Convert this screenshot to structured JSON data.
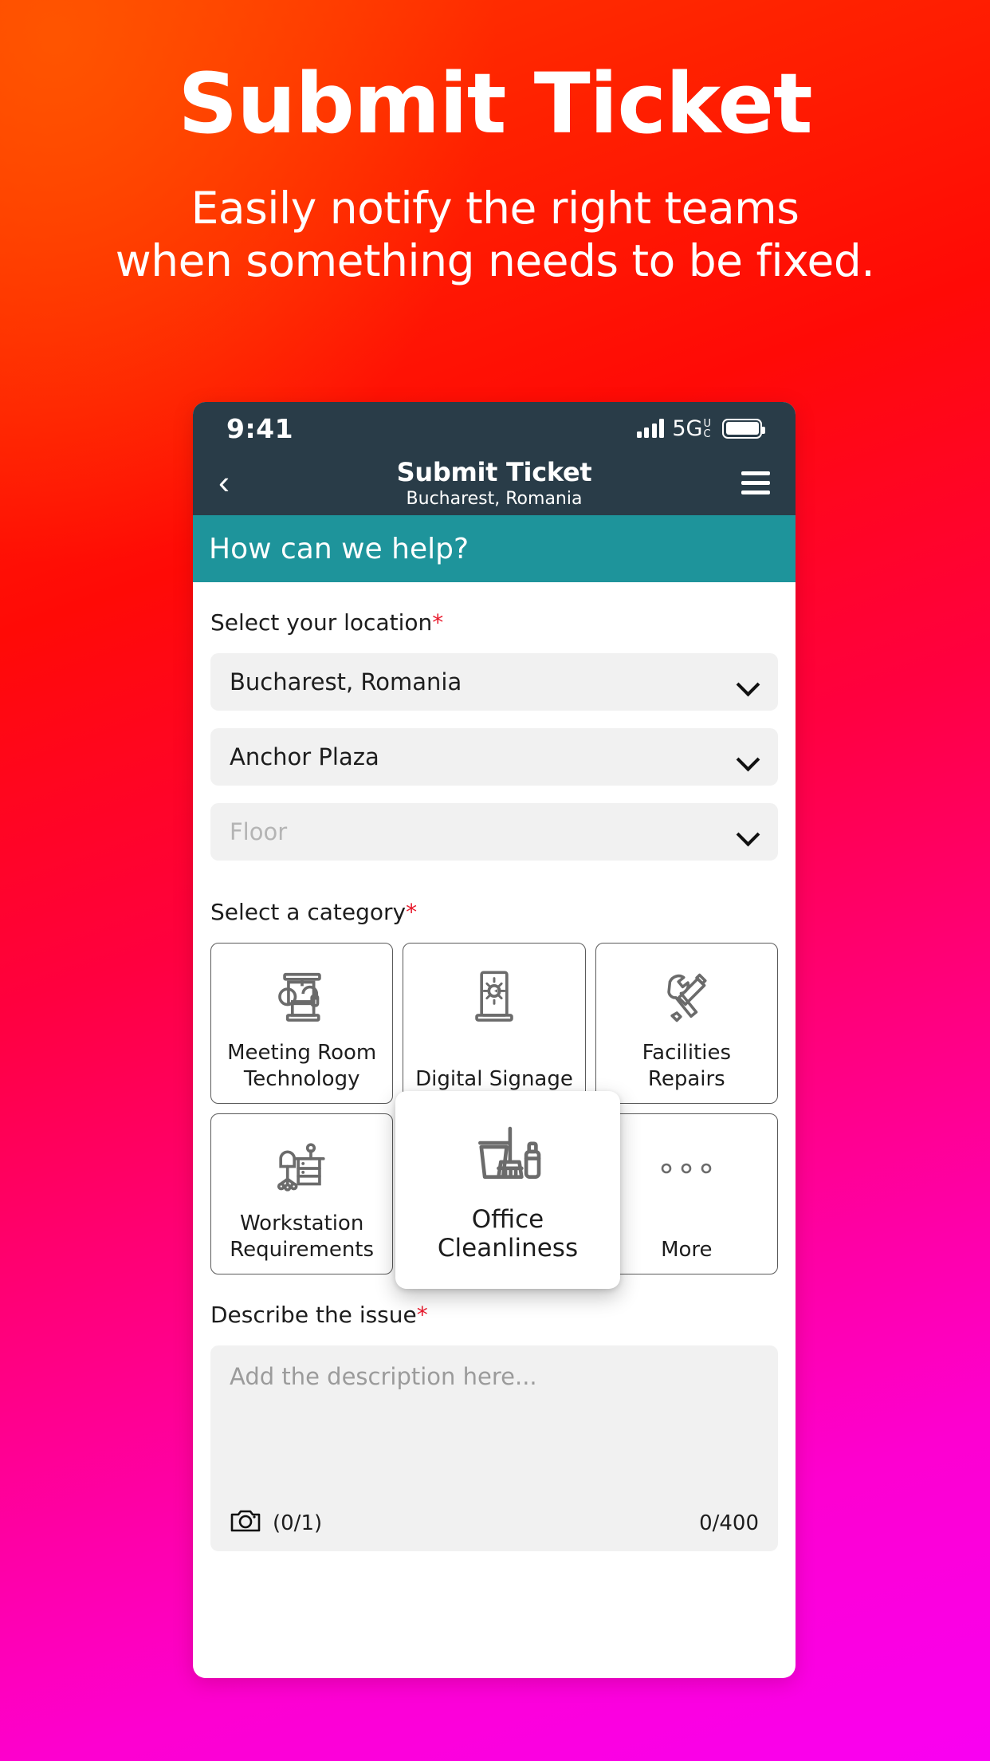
{
  "hero": {
    "title": "Submit Ticket",
    "subtitle_line1": "Easily notify the right teams",
    "subtitle_line2": "when something needs to be fixed."
  },
  "colors": {
    "gradient_start": "#FF3A00",
    "gradient_mid": "#FF0040",
    "gradient_end": "#F900F2",
    "header_navy": "#293C48",
    "banner_teal": "#1E949B",
    "required_red": "#E8192C",
    "field_grey": "#F1F1F1"
  },
  "status_bar": {
    "time": "9:41",
    "network": "5G",
    "network_suffix_top": "U",
    "network_suffix_bottom": "C",
    "signal_icon": "signal-bars-icon",
    "battery_icon": "battery-full-icon"
  },
  "navbar": {
    "back_icon": "chevron-left-icon",
    "title": "Submit Ticket",
    "subtitle": "Bucharest, Romania",
    "menu_icon": "hamburger-menu-icon"
  },
  "banner": {
    "text": "How can we help?"
  },
  "location_section": {
    "label": "Select your location",
    "required_marker": "*",
    "selects": [
      {
        "value": "Bucharest, Romania",
        "is_placeholder": false,
        "icon": "chevron-down-icon"
      },
      {
        "value": "Anchor Plaza",
        "is_placeholder": false,
        "icon": "chevron-down-icon"
      },
      {
        "value": "Floor",
        "is_placeholder": true,
        "icon": "chevron-down-icon"
      }
    ]
  },
  "category_section": {
    "label": "Select a category",
    "required_marker": "*",
    "items": [
      {
        "label": "Meeting Room Technology",
        "icon": "meeting-room-technology-icon",
        "selected": false
      },
      {
        "label": "Digital Signage",
        "icon": "digital-signage-icon",
        "selected": false
      },
      {
        "label": "Facilities Repairs",
        "icon": "hammer-screwdriver-icon",
        "selected": false
      },
      {
        "label": "Workstation Requirements",
        "icon": "desk-chair-icon",
        "selected": false
      },
      {
        "label": "Office Cleanliness",
        "icon": "cleaning-supplies-icon",
        "selected": true
      },
      {
        "label": "More",
        "icon": "three-dots-icon",
        "selected": false
      }
    ]
  },
  "description_section": {
    "label": "Describe the issue",
    "required_marker": "*",
    "placeholder": "Add the description here...",
    "value": "",
    "camera_icon": "camera-icon",
    "attachment_count": "(0/1)",
    "char_count": "0/400"
  }
}
